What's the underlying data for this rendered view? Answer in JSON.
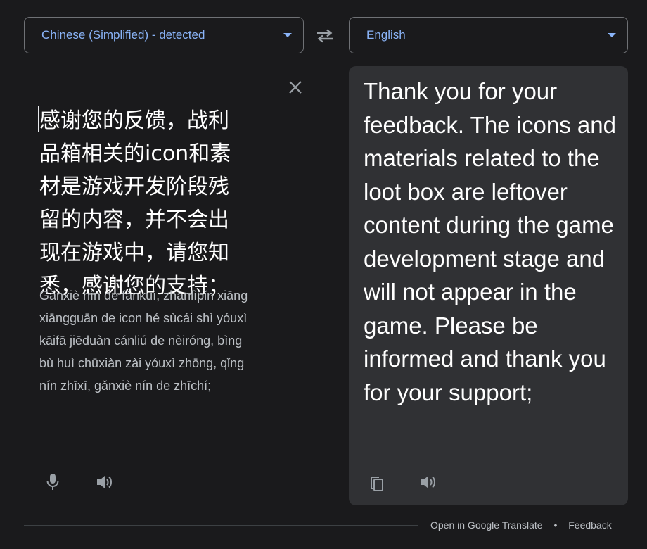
{
  "source_language": {
    "label": "Chinese (Simplified) - detected"
  },
  "target_language": {
    "label": "English"
  },
  "source": {
    "lines": [
      "感谢您的反馈，战利",
      "品箱相关的icon和素",
      "材是游戏开发阶段残",
      "留的内容，并不会出",
      "现在游戏中，请您知",
      "悉，感谢您的支持；"
    ],
    "pinyin_lines": [
      "Gǎnxiè nín de fǎnkuì, zhànlìpǐn xiāng",
      "xiāngguān de icon hé sùcái shì yóuxì",
      "kāifā jiēduàn cánliú de nèiróng, bìng",
      "bù huì chūxiàn zài yóuxì zhōng, qǐng",
      "nín zhīxī, gǎnxiè nín de zhīchí;"
    ]
  },
  "translation": {
    "text": "Thank you for your feedback. The icons and materials related to the loot box are leftover content during the game development stage and will not appear in the game. Please be informed and thank you for your support;"
  },
  "footer": {
    "open_link": "Open in Google Translate",
    "separator": "•",
    "feedback_link": "Feedback"
  },
  "icons": {
    "swap": "swap-arrows-icon",
    "clear": "close-icon",
    "mic": "microphone-icon",
    "speaker": "speaker-icon",
    "copy": "copy-icon",
    "dropdown": "caret-down-icon"
  },
  "colors": {
    "background": "#1a1a1c",
    "panel": "#303134",
    "accent": "#8ab4f8",
    "text": "#ffffff",
    "muted": "#bdc1c6"
  }
}
